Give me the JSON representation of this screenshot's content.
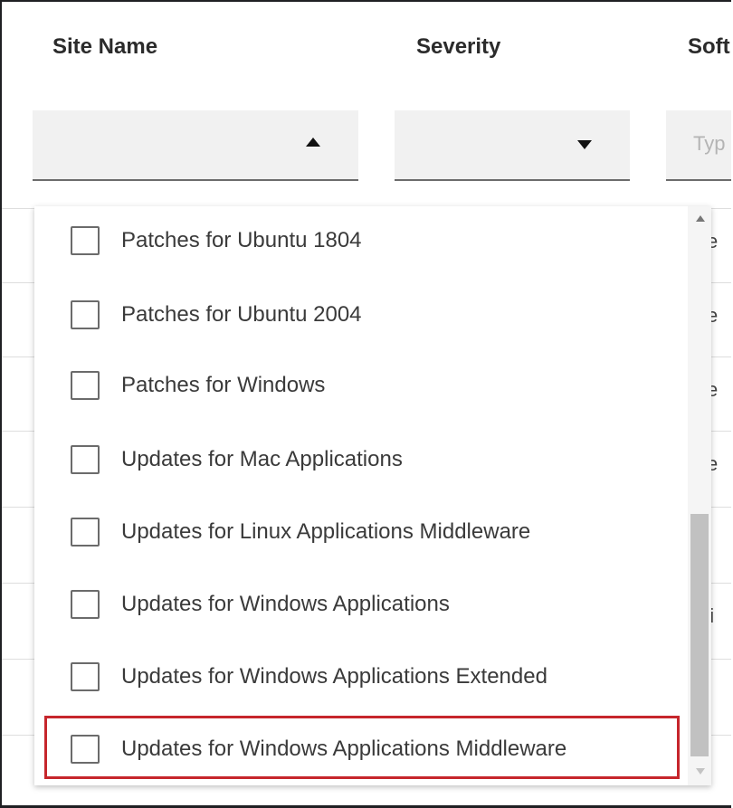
{
  "columns": {
    "site_name": "Site Name",
    "severity": "Severity",
    "software": "Soft"
  },
  "filters": {
    "site_name_arrow": "arrow-up",
    "severity_arrow": "arrow-down",
    "software_placeholder": "Typ"
  },
  "background_rows": [
    "ce",
    "ce",
    "ce",
    "ce",
    "\\>",
    "Vi",
    "\\>",
    "\\>"
  ],
  "dropdown": {
    "options": [
      {
        "label": "Patches for Ubuntu 1804",
        "checked": false
      },
      {
        "label": "Patches for Ubuntu 2004",
        "checked": false
      },
      {
        "label": "Patches for Windows",
        "checked": false
      },
      {
        "label": "Updates for Mac Applications",
        "checked": false
      },
      {
        "label": "Updates for Linux Applications Middleware",
        "checked": false
      },
      {
        "label": "Updates for Windows Applications",
        "checked": false
      },
      {
        "label": "Updates for Windows Applications Extended",
        "checked": false
      },
      {
        "label": "Updates for Windows Applications Middleware",
        "checked": false,
        "highlighted": true
      }
    ]
  },
  "colors": {
    "highlight_border": "#c6262c",
    "filter_bg": "#f1f1f1"
  }
}
